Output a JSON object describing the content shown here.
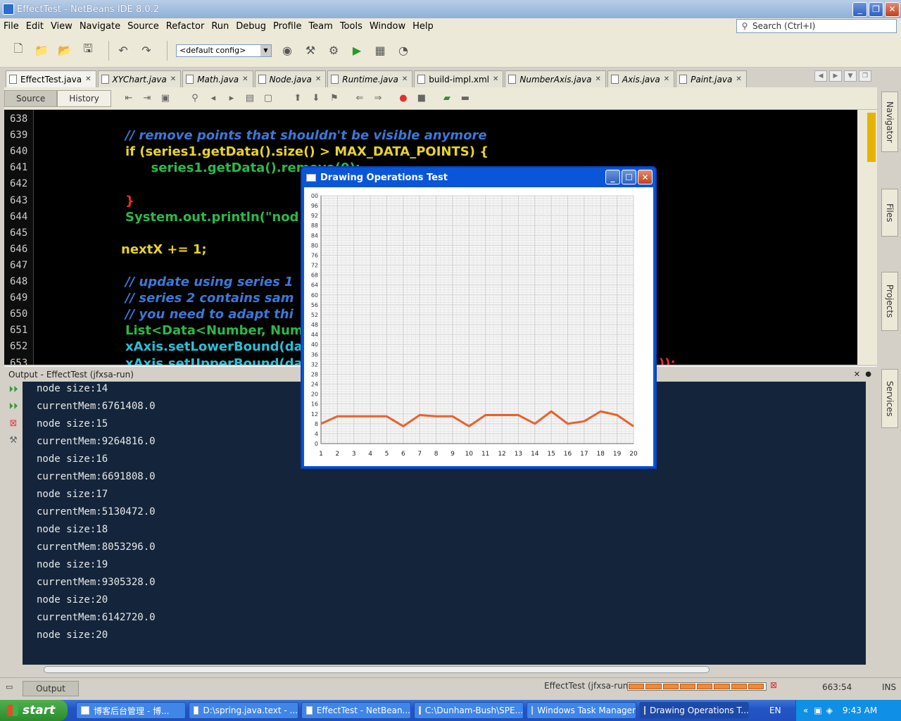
{
  "window": {
    "title": "EffectTest - NetBeans IDE 8.0.2"
  },
  "menu": [
    "File",
    "Edit",
    "View",
    "Navigate",
    "Source",
    "Refactor",
    "Run",
    "Debug",
    "Profile",
    "Team",
    "Tools",
    "Window",
    "Help"
  ],
  "search": {
    "placeholder": "Search (Ctrl+I)"
  },
  "toolbar": {
    "config": "<default config>"
  },
  "tabs": [
    "EffectTest.java",
    "XYChart.java",
    "Math.java",
    "Node.java",
    "Runtime.java",
    "build-impl.xml",
    "NumberAxis.java",
    "Axis.java",
    "Paint.java"
  ],
  "editor_toolbar": {
    "source": "Source",
    "history": "History"
  },
  "editor": {
    "line_numbers": [
      "638",
      "639",
      "640",
      "641",
      "642",
      "643",
      "644",
      "645",
      "646",
      "647",
      "648",
      "649",
      "650",
      "651",
      "652",
      "653"
    ],
    "lines": [
      {
        "text": ""
      },
      {
        "text": "// remove points that shouldn't be visible anymore"
      },
      {
        "text": "if (series1.getData().size() > MAX_DATA_POINTS) {"
      },
      {
        "text": "  series1.getData().remove(0);"
      },
      {
        "text": ""
      },
      {
        "text": "}"
      },
      {
        "text": "System.out.println(\"nod"
      },
      {
        "text": ""
      },
      {
        "text": "nextX += 1;"
      },
      {
        "text": ""
      },
      {
        "text": "// update using series 1"
      },
      {
        "text": "// series 2 contains sam"
      },
      {
        "text": "// you need to adapt thi"
      },
      {
        "text": "List<Data<Number, Num"
      },
      {
        "text": "xAxis.setLowerBound(da"
      },
      {
        "text": "xAxis.setUpperBound(da"
      }
    ],
    "tail_fragment": "));"
  },
  "right_tabs": [
    "Navigator",
    "Files",
    "Projects",
    "Services"
  ],
  "output": {
    "header_label": "Output -",
    "header_title": "EffectTest (jfxsa-run)",
    "lines": [
      "node size:14",
      "currentMem:6761408.0",
      "node size:15",
      "currentMem:9264816.0",
      "node size:16",
      "currentMem:6691808.0",
      "node size:17",
      "currentMem:5130472.0",
      "node size:18",
      "currentMem:8053296.0",
      "node size:19",
      "currentMem:9305328.0",
      "node size:20",
      "currentMem:6142720.0",
      "node size:20"
    ]
  },
  "status": {
    "output_button": "Output",
    "task": "EffectTest (jfxsa-run)",
    "position": "663:54",
    "mode": "INS"
  },
  "taskbar": {
    "start": "start",
    "items": [
      "博客后台管理 - 博...",
      "D:\\spring.java.text - ...",
      "EffectTest - NetBean...",
      "C:\\Dunham-Bush\\SPE...",
      "Windows Task Manager",
      "Drawing Operations T..."
    ],
    "lang": "EN",
    "clock": "9:43 AM"
  },
  "dialog": {
    "title": "Drawing Operations Test"
  },
  "chart_data": {
    "type": "line",
    "x": [
      1,
      2,
      3,
      4,
      5,
      6,
      7,
      8,
      9,
      10,
      11,
      12,
      13,
      14,
      15,
      16,
      17,
      18,
      19,
      20
    ],
    "series": [
      {
        "values": [
          8,
          11,
          11,
          11,
          11,
          7,
          11.5,
          11,
          11,
          7,
          11.5,
          11.5,
          11.5,
          8,
          13,
          8,
          9,
          13,
          11.5,
          7
        ]
      }
    ],
    "xlim": [
      1,
      20
    ],
    "ylim": [
      0,
      100
    ],
    "x_ticks": [
      "1",
      "2",
      "3",
      "4",
      "5",
      "6",
      "7",
      "8",
      "9",
      "10",
      "11",
      "12",
      "13",
      "14",
      "15",
      "16",
      "17",
      "18",
      "19",
      "20"
    ],
    "y_ticks": [
      "0",
      "4",
      "8",
      "12",
      "16",
      "20",
      "24",
      "28",
      "32",
      "36",
      "40",
      "44",
      "48",
      "52",
      "56",
      "60",
      "64",
      "68",
      "72",
      "76",
      "80",
      "84",
      "88",
      "92",
      "96",
      "00"
    ],
    "grid": true,
    "line_color": "#e8622c"
  }
}
